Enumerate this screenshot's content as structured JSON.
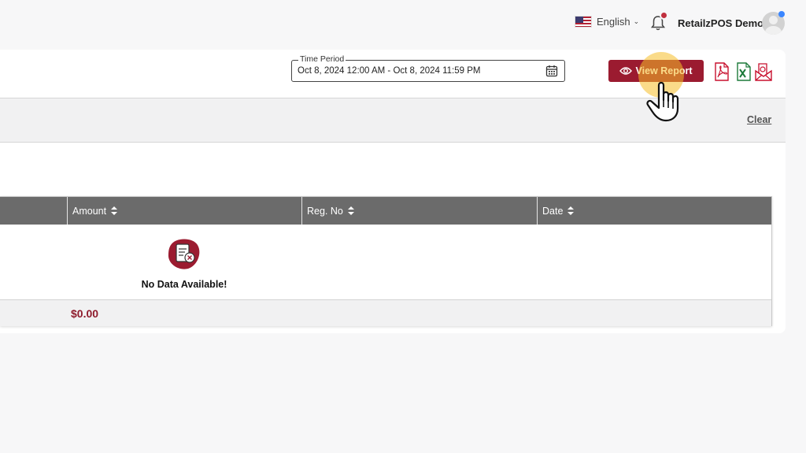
{
  "header": {
    "language": "English",
    "user_name": "RetailzPOS Demo"
  },
  "filters": {
    "time_period_label": "Time Period",
    "time_period_value": "Oct 8, 2024 12:00 AM - Oct 8, 2024 11:59 PM",
    "view_report_label": "View Report",
    "clear_label": "Clear"
  },
  "table": {
    "columns": [
      "Amount",
      "Reg. No",
      "Date"
    ],
    "empty_message": "No Data Available!",
    "total_amount": "$0.00"
  },
  "colors": {
    "primary": "#9b1b30",
    "header_bg": "#6b6b6b",
    "total_text": "#8e1b2c"
  },
  "icons": [
    "us-flag-icon",
    "chevron-down-icon",
    "bell-icon",
    "avatar-icon",
    "calendar-icon",
    "eye-icon",
    "pdf-export-icon",
    "excel-export-icon",
    "email-report-icon",
    "no-data-icon",
    "sort-icon",
    "hand-pointer-icon"
  ]
}
